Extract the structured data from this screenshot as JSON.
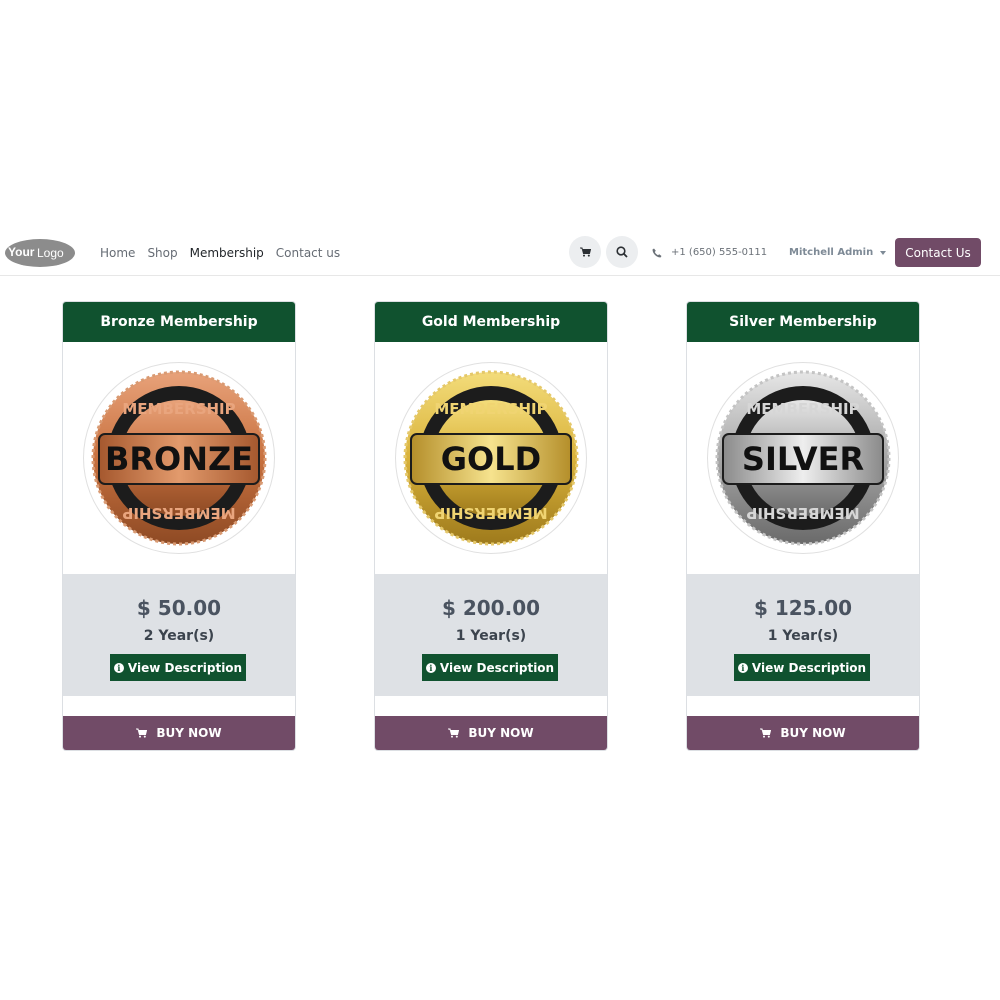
{
  "header": {
    "logo_text_bold": "Your",
    "logo_text_light": "Logo",
    "nav": [
      {
        "label": "Home",
        "active": false
      },
      {
        "label": "Shop",
        "active": false
      },
      {
        "label": "Membership",
        "active": true
      },
      {
        "label": "Contact us",
        "active": false
      }
    ],
    "cart_icon": "cart-icon",
    "search_icon": "search-icon",
    "phone_icon": "phone-icon",
    "phone": "+1 (650) 555-0111",
    "user": "Mitchell Admin",
    "contact_button": "Contact Us"
  },
  "cards": [
    {
      "title": "Bronze Membership",
      "badge_top": "MEMBERSHIP",
      "badge_word": "BRONZE",
      "badge_bottom": "MEMBERSHIP",
      "price": "$ 50.00",
      "duration": "2  Year(s)",
      "view_label": "View Description",
      "buy_label": "BUY NOW"
    },
    {
      "title": "Gold Membership",
      "badge_top": "MEMBERSHIP",
      "badge_word": "GOLD",
      "badge_bottom": "MEMBERSHIP",
      "price": "$ 200.00",
      "duration": "1  Year(s)",
      "view_label": "View Description",
      "buy_label": "BUY NOW"
    },
    {
      "title": "Silver Membership",
      "badge_top": "MEMBERSHIP",
      "badge_word": "SILVER",
      "badge_bottom": "MEMBERSHIP",
      "price": "$ 125.00",
      "duration": "1  Year(s)",
      "view_label": "View Description",
      "buy_label": "BUY NOW"
    }
  ],
  "colors": {
    "header_green": "#10522f",
    "brand_purple": "#714b67",
    "price_bg": "#dee1e5",
    "bronze": "#c8713f",
    "gold": "#d9b23a",
    "silver": "#a6a6a6"
  }
}
